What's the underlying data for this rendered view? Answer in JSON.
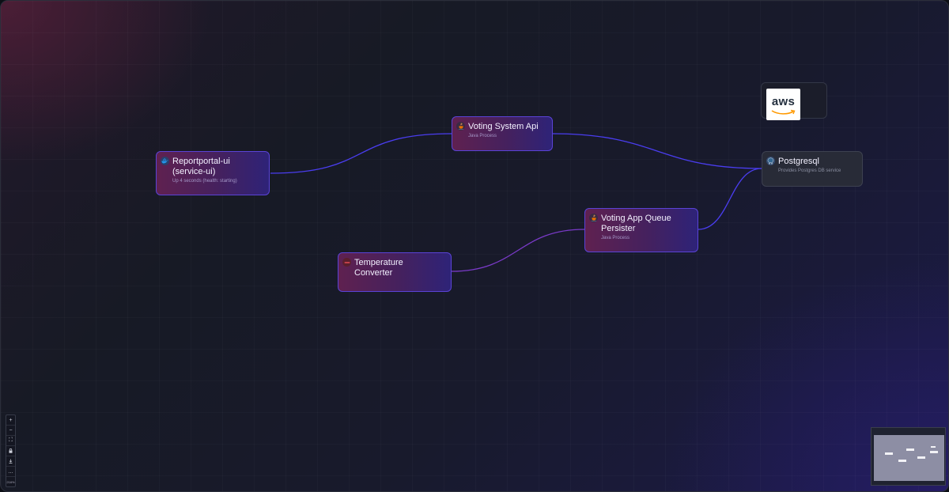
{
  "nodes": {
    "reportportal": {
      "title": "Reportportal-ui (service-ui)",
      "subtitle": "Up 4 seconds (health: starting)",
      "icon": "docker-whale-icon"
    },
    "voting_api": {
      "title": "Voting System Api",
      "subtitle": "Java Process",
      "icon": "java-cup-icon"
    },
    "postgresql": {
      "title": "Postgresql",
      "subtitle": "Provides Postgres DB service",
      "icon": "postgres-elephant-icon"
    },
    "queue_persister": {
      "title": "Voting App Queue Persister",
      "subtitle": "Java Process",
      "icon": "java-cup-icon"
    },
    "temp_converter": {
      "title": "Temperature Converter",
      "subtitle": "",
      "icon": "service-icon"
    }
  },
  "aws": {
    "label": "aws",
    "icon": "aws-logo-icon"
  },
  "edges": [
    {
      "from": "reportportal",
      "to": "voting_api"
    },
    {
      "from": "voting_api",
      "to": "postgresql"
    },
    {
      "from": "queue_persister",
      "to": "postgresql"
    },
    {
      "from": "temp_converter",
      "to": "queue_persister"
    }
  ],
  "controls": {
    "zoom_in": "+",
    "zoom_out": "−",
    "fit_view": "⛶",
    "lock": "🔒",
    "download": "⬇",
    "more": "…",
    "zoom_level": "216%"
  },
  "colors": {
    "edge": "#4a3df0",
    "node_border": "#5a43d6",
    "node_grad_start": "#5f2150",
    "node_grad_end": "#2e2378"
  }
}
